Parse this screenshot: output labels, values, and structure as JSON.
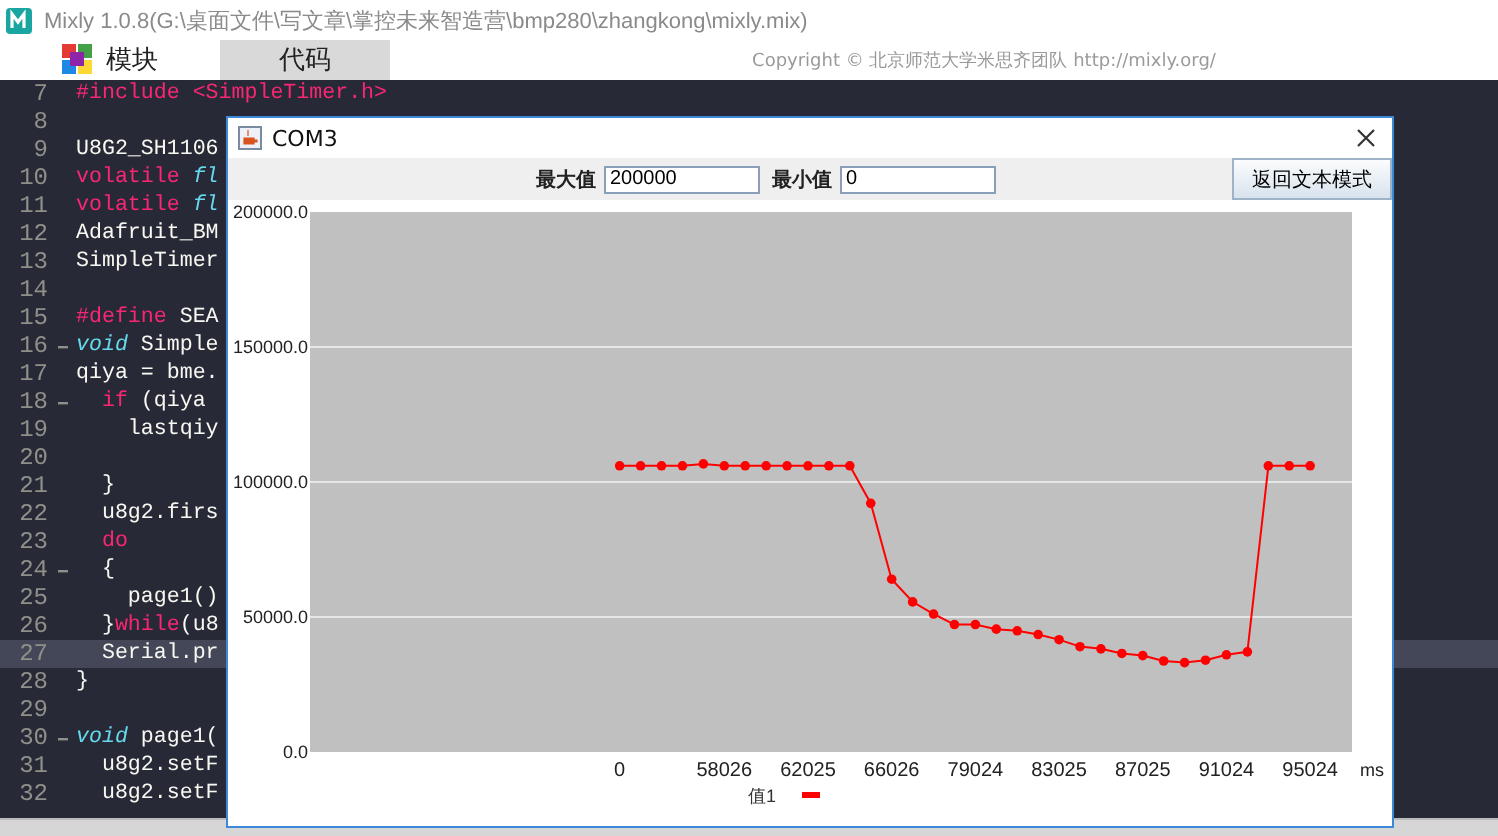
{
  "app": {
    "title": "Mixly 1.0.8(G:\\桌面文件\\写文章\\掌控未来智造营\\bmp280\\zhangkong\\mixly.mix)"
  },
  "tabs": [
    {
      "label": "模块",
      "selected": false
    },
    {
      "label": "代码",
      "selected": true
    }
  ],
  "copyright": "Copyright © 北京师范大学米思齐团队 http://mixly.org/",
  "editor": {
    "lines": [
      {
        "number": "7",
        "foldable": false,
        "highlighted": false,
        "tokens": [
          {
            "kind": "keyword",
            "text": "#include <SimpleTimer.h>"
          }
        ]
      },
      {
        "number": "8",
        "foldable": false,
        "highlighted": false
      },
      {
        "number": "9",
        "foldable": false,
        "highlighted": false,
        "tokens": [
          {
            "kind": "plain",
            "text": "U8G2_SH1106"
          }
        ]
      },
      {
        "number": "10",
        "foldable": false,
        "highlighted": false,
        "tokens": [
          {
            "kind": "keyword",
            "text": "volatile"
          },
          {
            "kind": "type",
            "text": " fl"
          }
        ]
      },
      {
        "number": "11",
        "foldable": false,
        "highlighted": false,
        "tokens": [
          {
            "kind": "keyword",
            "text": "volatile"
          },
          {
            "kind": "type",
            "text": " fl"
          }
        ]
      },
      {
        "number": "12",
        "foldable": false,
        "highlighted": false,
        "tokens": [
          {
            "kind": "plain",
            "text": "Adafruit_BM"
          }
        ]
      },
      {
        "number": "13",
        "foldable": false,
        "highlighted": false,
        "tokens": [
          {
            "kind": "plain",
            "text": "SimpleTimer"
          }
        ]
      },
      {
        "number": "14",
        "foldable": false,
        "highlighted": false
      },
      {
        "number": "15",
        "foldable": false,
        "highlighted": false,
        "tokens": [
          {
            "kind": "keyword",
            "text": "#define"
          },
          {
            "kind": "plain",
            "text": " SEA"
          }
        ]
      },
      {
        "number": "16",
        "foldable": true,
        "highlighted": false,
        "tokens": [
          {
            "kind": "type",
            "text": "void"
          },
          {
            "kind": "plain",
            "text": " Simple"
          }
        ]
      },
      {
        "number": "17",
        "foldable": false,
        "highlighted": false,
        "tokens": [
          {
            "kind": "plain",
            "text": "qiya = bme."
          }
        ]
      },
      {
        "number": "18",
        "foldable": true,
        "highlighted": false,
        "tokens": [
          {
            "kind": "keyword",
            "text": "  if"
          },
          {
            "kind": "plain",
            "text": " (qiya"
          }
        ]
      },
      {
        "number": "19",
        "foldable": false,
        "highlighted": false,
        "tokens": [
          {
            "kind": "plain",
            "text": "    lastqiy"
          }
        ]
      },
      {
        "number": "20",
        "foldable": false,
        "highlighted": false
      },
      {
        "number": "21",
        "foldable": false,
        "highlighted": false,
        "tokens": [
          {
            "kind": "plain",
            "text": "  }"
          }
        ]
      },
      {
        "number": "22",
        "foldable": false,
        "highlighted": false,
        "tokens": [
          {
            "kind": "plain",
            "text": "  u8g2.firs"
          }
        ]
      },
      {
        "number": "23",
        "foldable": false,
        "highlighted": false,
        "tokens": [
          {
            "kind": "keyword",
            "text": "  do"
          }
        ]
      },
      {
        "number": "24",
        "foldable": true,
        "highlighted": false,
        "tokens": [
          {
            "kind": "plain",
            "text": "  {"
          }
        ]
      },
      {
        "number": "25",
        "foldable": false,
        "highlighted": false,
        "tokens": [
          {
            "kind": "plain",
            "text": "    page1()"
          }
        ]
      },
      {
        "number": "26",
        "foldable": false,
        "highlighted": false,
        "tokens": [
          {
            "kind": "plain",
            "text": "  }"
          },
          {
            "kind": "keyword",
            "text": "while"
          },
          {
            "kind": "plain",
            "text": "(u8"
          }
        ]
      },
      {
        "number": "27",
        "foldable": false,
        "highlighted": true,
        "tokens": [
          {
            "kind": "plain",
            "text": "  Serial.pr"
          }
        ]
      },
      {
        "number": "28",
        "foldable": false,
        "highlighted": false,
        "tokens": [
          {
            "kind": "plain",
            "text": "}"
          }
        ]
      },
      {
        "number": "29",
        "foldable": false,
        "highlighted": false
      },
      {
        "number": "30",
        "foldable": true,
        "highlighted": false,
        "tokens": [
          {
            "kind": "type",
            "text": "void"
          },
          {
            "kind": "plain",
            "text": " page1("
          }
        ]
      },
      {
        "number": "31",
        "foldable": false,
        "highlighted": false,
        "tokens": [
          {
            "kind": "plain",
            "text": "  u8g2.setF"
          }
        ]
      },
      {
        "number": "32",
        "foldable": false,
        "highlighted": false,
        "tokens": [
          {
            "kind": "plain",
            "text": "  u8g2.setF"
          }
        ]
      }
    ]
  },
  "dialog": {
    "title": "COM3",
    "max_label": "最大值",
    "max_value": "200000",
    "min_label": "最小值",
    "min_value": "0",
    "mode_button": "返回文本模式",
    "chart_data": {
      "type": "line",
      "xlabel": "ms",
      "ylim": [
        0,
        200000
      ],
      "grid": true,
      "categories": [
        "0",
        null,
        null,
        null,
        null,
        "58026",
        null,
        null,
        null,
        "62025",
        null,
        null,
        null,
        "66026",
        null,
        null,
        null,
        "79024",
        null,
        null,
        null,
        "83025",
        null,
        null,
        null,
        "87025",
        null,
        null,
        null,
        "91024",
        null,
        null,
        null,
        "95024"
      ],
      "yticks": [
        {
          "value": 0,
          "label": "0.0"
        },
        {
          "value": 50000,
          "label": "50000.0"
        },
        {
          "value": 100000,
          "label": "100000.0"
        },
        {
          "value": 150000,
          "label": "150000.0"
        },
        {
          "value": 200000,
          "label": "200000.0"
        }
      ],
      "series": [
        {
          "name": "值1",
          "color": "#ff0000",
          "marker": "circle",
          "values": [
            106000,
            106000,
            106000,
            106000,
            106700,
            106000,
            106000,
            106000,
            106000,
            106000,
            106000,
            106000,
            92100,
            64000,
            55600,
            51100,
            47200,
            47200,
            45500,
            44900,
            43500,
            41600,
            39000,
            38200,
            36500,
            35700,
            33700,
            33100,
            34000,
            36000,
            37100,
            106000,
            106000,
            106000
          ]
        }
      ]
    }
  }
}
